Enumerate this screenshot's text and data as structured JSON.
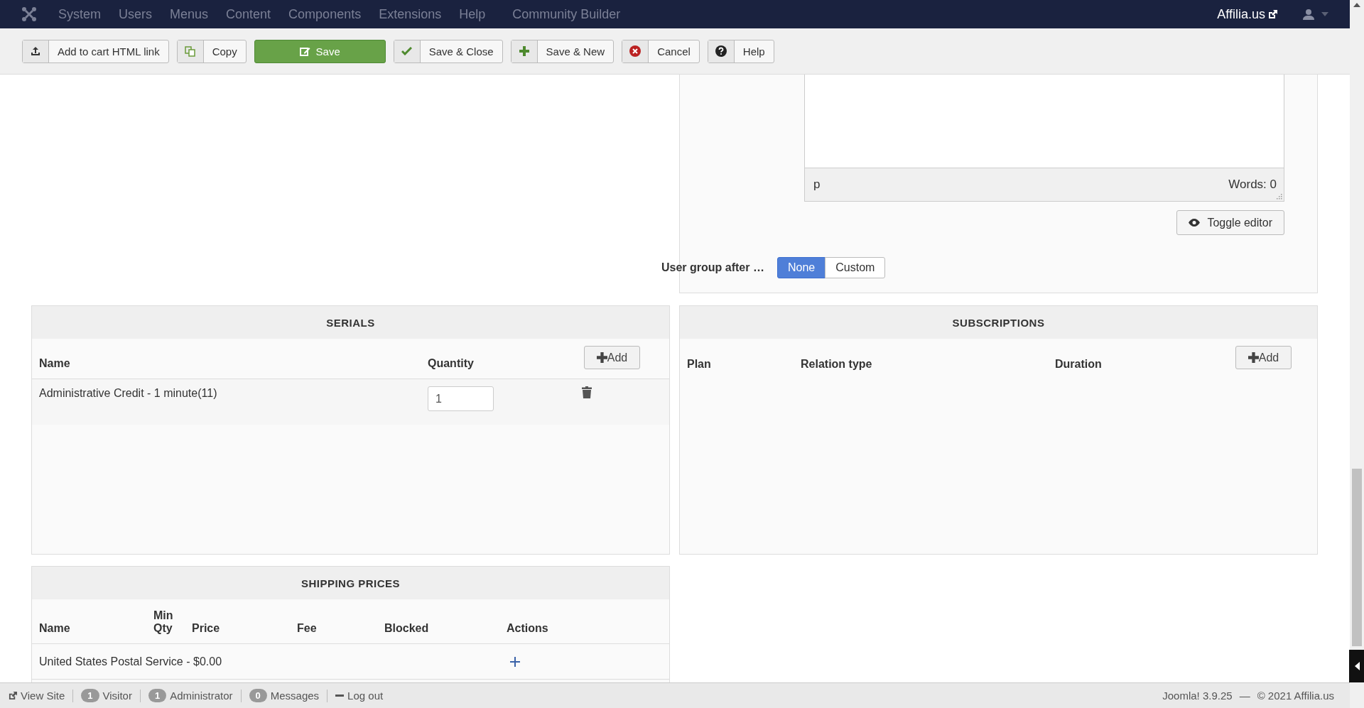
{
  "navbar": {
    "menu": [
      "System",
      "Users",
      "Menus",
      "Content",
      "Components",
      "Extensions",
      "Help",
      "Community Builder"
    ],
    "site_link": "Affilia.us"
  },
  "toolbar": [
    {
      "label": "Add to cart HTML link",
      "kind": "upload"
    },
    {
      "label": "Copy",
      "kind": "copy"
    },
    {
      "label": "Save",
      "kind": "save"
    },
    {
      "label": "Save & Close",
      "kind": "check"
    },
    {
      "label": "Save & New",
      "kind": "plus"
    },
    {
      "label": "Cancel",
      "kind": "cancel"
    },
    {
      "label": "Help",
      "kind": "help"
    }
  ],
  "editor": {
    "path": "p",
    "word_count": "Words: 0",
    "toggle_button": "Toggle editor"
  },
  "user_group": {
    "label": "User group after …",
    "options": [
      {
        "label": "None",
        "selected": true
      },
      {
        "label": "Custom",
        "selected": false
      }
    ]
  },
  "serials": {
    "title": "SERIALS",
    "columns": [
      "Name",
      "Quantity"
    ],
    "add_button": "Add",
    "rows": [
      {
        "name": "Administrative Credit - 1 minute(11)",
        "quantity": "1"
      }
    ]
  },
  "subscriptions": {
    "title": "SUBSCRIPTIONS",
    "columns": [
      "Plan",
      "Relation type",
      "Duration"
    ],
    "add_button": "Add"
  },
  "shipping": {
    "title": "SHIPPING PRICES",
    "columns": [
      "Name",
      "Min Qty",
      "Price",
      "Fee",
      "Blocked",
      "Actions"
    ],
    "rows": [
      {
        "name": "United States Postal Service - $0.00"
      }
    ]
  },
  "status_bar": {
    "view_site": "View Site",
    "badges": [
      {
        "count": "1",
        "label": "Visitor"
      },
      {
        "count": "1",
        "label": "Administrator"
      },
      {
        "count": "0",
        "label": "Messages"
      }
    ],
    "logout": "Log out",
    "version": "Joomla! 3.9.25",
    "separator": "—",
    "copyright": "© 2021 Affilia.us"
  }
}
